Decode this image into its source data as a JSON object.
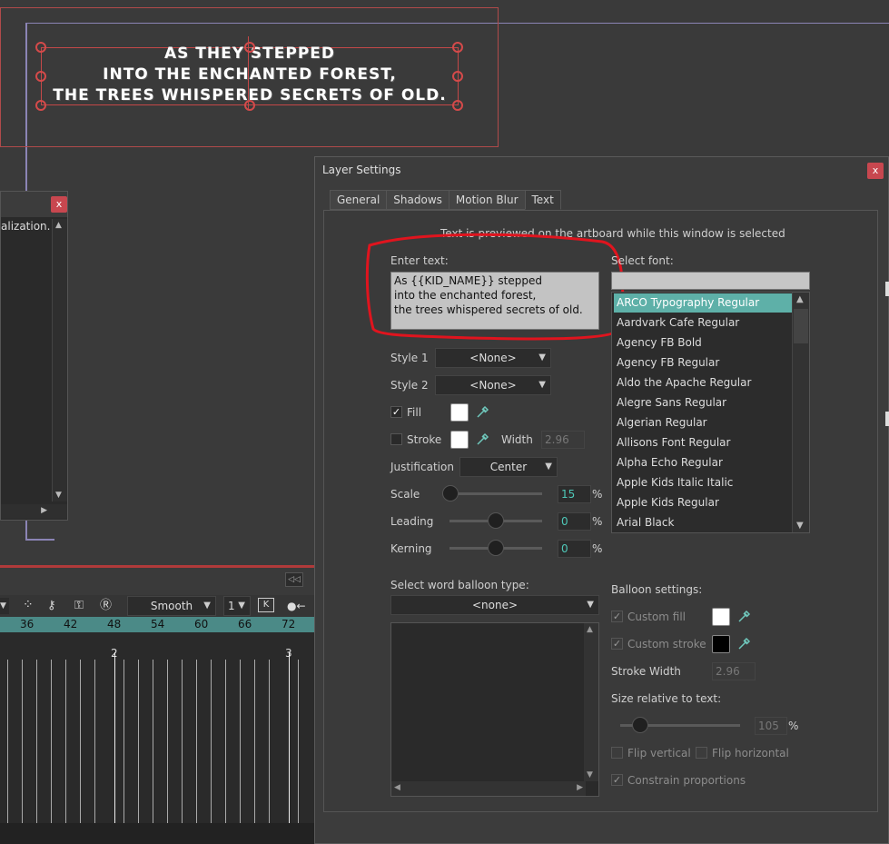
{
  "artboard": {
    "lines": [
      "AS THEY STEPPED",
      "INTO THE ENCHANTED FOREST,",
      "THE TREES WHISPERED SECRETS OF OLD."
    ]
  },
  "left_panel": {
    "text": "alization.",
    "close_label": "x"
  },
  "timeline": {
    "interpolation": "Smooth",
    "step": "1",
    "key_label": "K",
    "ruler_numbers": [
      "36",
      "42",
      "48",
      "54",
      "60",
      "66",
      "72"
    ],
    "seconds": [
      "2",
      "3"
    ]
  },
  "dialog": {
    "title": "Layer Settings",
    "close_label": "x",
    "tabs": [
      "General",
      "Shadows",
      "Motion Blur",
      "Text"
    ],
    "active_tab": "Text",
    "preview_note": "Text is previewed on the artboard while this window is selected",
    "enter_text_label": "Enter text:",
    "enter_text_value": "As {{KID_NAME}} stepped\ninto the enchanted forest,\nthe trees whispered secrets of old.",
    "style1_label": "Style 1",
    "style1_value": "<None>",
    "style2_label": "Style 2",
    "style2_value": "<None>",
    "fill_label": "Fill",
    "fill_checked": true,
    "fill_color": "#ffffff",
    "stroke_label": "Stroke",
    "stroke_checked": false,
    "stroke_color": "#ffffff",
    "width_label": "Width",
    "width_value": "2.96",
    "justification_label": "Justification",
    "justification_value": "Center",
    "scale_label": "Scale",
    "scale_value": "15",
    "leading_label": "Leading",
    "leading_value": "0",
    "kerning_label": "Kerning",
    "kerning_value": "0",
    "percent": "%",
    "select_font_label": "Select font:",
    "fonts": [
      "ARCO Typography Regular",
      "Aardvark Cafe Regular",
      "Agency FB Bold",
      "Agency FB Regular",
      "Aldo the Apache Regular",
      "Alegre Sans Regular",
      "Algerian Regular",
      "Allisons Font Regular",
      "Alpha Echo Regular",
      "Apple Kids Italic Italic",
      "Apple Kids Regular",
      "Arial Black"
    ],
    "selected_font": "ARCO Typography Regular",
    "balloon_type_label": "Select word balloon type:",
    "balloon_type_value": "<none>",
    "balloon_settings_label": "Balloon settings:",
    "custom_fill_label": "Custom fill",
    "custom_fill_color": "#ffffff",
    "custom_stroke_label": "Custom stroke",
    "custom_stroke_color": "#000000",
    "stroke_width_label": "Stroke Width",
    "stroke_width_value": "2.96",
    "size_relative_label": "Size relative to text:",
    "size_relative_value": "105",
    "flip_vertical_label": "Flip vertical",
    "flip_horizontal_label": "Flip horizontal",
    "constrain_label": "Constrain proportions"
  },
  "colors": {
    "accent": "#5eb0a8",
    "close_red": "#c8474f",
    "annotation_red": "#e0141e"
  }
}
